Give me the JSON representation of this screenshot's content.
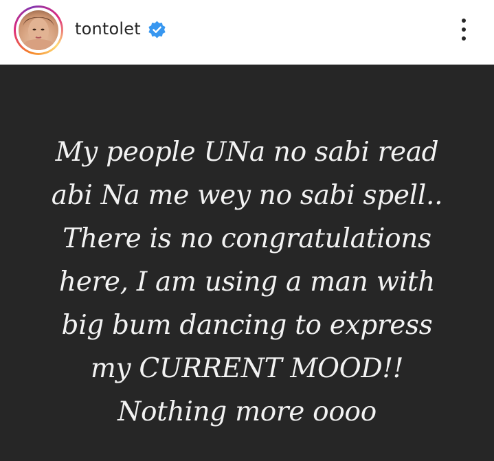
{
  "header": {
    "username": "tontolet",
    "verified": true,
    "avatar_icon": "profile-photo",
    "more_icon": "more-vertical-icon"
  },
  "post": {
    "background_color": "#262626",
    "text_color": "#f2f2f2",
    "caption_lines": [
      "My people UNa no sabi read",
      "abi Na me wey no sabi spell..",
      "There is no congratulations",
      "here, I am using a man with",
      "big bum dancing to express",
      "my CURRENT MOOD!!",
      "Nothing more oooo"
    ]
  },
  "colors": {
    "verified_blue": "#3897f0",
    "ring_orange": "#f58529",
    "ring_pink": "#dd2a7b"
  }
}
